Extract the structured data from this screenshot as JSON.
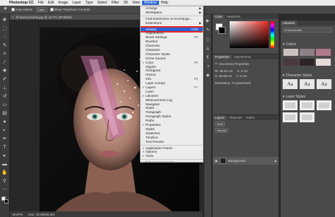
{
  "menubar": {
    "apple": "",
    "items": [
      {
        "label": "Photoshop CC",
        "app": true
      },
      {
        "label": "File"
      },
      {
        "label": "Edit"
      },
      {
        "label": "Image"
      },
      {
        "label": "Layer"
      },
      {
        "label": "Type"
      },
      {
        "label": "Select"
      },
      {
        "label": "Filter"
      },
      {
        "label": "3D"
      },
      {
        "label": "View"
      },
      {
        "label": "Window",
        "active": true
      },
      {
        "label": "Help"
      }
    ]
  },
  "optionsbar": {
    "auto_select": "Auto-Select:",
    "layer_select": "Layer",
    "show_transform": "Show Transform Controls"
  },
  "document": {
    "tab_title": "hl-beert-presets.jpg @ 16.7% (RGB/8#)",
    "zoom": "16.67%",
    "doc_size": "Doc: 40.2M/40.2M"
  },
  "window_menu": {
    "items": [
      {
        "label": "Arrange",
        "submenu": true
      },
      {
        "label": "Workspace",
        "submenu": true
      },
      {
        "sep": true
      },
      {
        "label": "Find Extensions on Exchange..."
      },
      {
        "label": "Extensions",
        "submenu": true
      },
      {
        "sep": true
      },
      {
        "label": "Actions",
        "shortcut": "⌥F9",
        "highlight": true
      },
      {
        "label": "Adjustments"
      },
      {
        "label": "Brush Settings",
        "shortcut": "F5"
      },
      {
        "label": "Brushes"
      },
      {
        "label": "Channels"
      },
      {
        "label": "Character"
      },
      {
        "label": "Character Styles"
      },
      {
        "label": "Clone Source"
      },
      {
        "label": "Color",
        "shortcut": "F6",
        "checked": true
      },
      {
        "label": "Glyphs"
      },
      {
        "label": "Histogram"
      },
      {
        "label": "History"
      },
      {
        "label": "Info",
        "shortcut": "F8"
      },
      {
        "label": "Layer Comps"
      },
      {
        "label": "Layers",
        "shortcut": "F7",
        "checked": true
      },
      {
        "label": "Learn"
      },
      {
        "label": "Libraries",
        "checked": true
      },
      {
        "label": "Measurement Log"
      },
      {
        "label": "Navigator"
      },
      {
        "label": "Notes"
      },
      {
        "label": "Paragraph"
      },
      {
        "label": "Paragraph Styles"
      },
      {
        "label": "Paths"
      },
      {
        "label": "Properties",
        "checked": true
      },
      {
        "label": "Styles"
      },
      {
        "label": "Swatches"
      },
      {
        "label": "Timeline"
      },
      {
        "label": "Tool Presets"
      },
      {
        "sep": true
      },
      {
        "label": "Application Frame",
        "checked": true
      },
      {
        "label": "Options",
        "checked": true
      },
      {
        "label": "Tools",
        "checked": true
      },
      {
        "sep": true
      },
      {
        "label": "hl-beert-presets.jpg",
        "checked": true
      }
    ]
  },
  "color_panel": {
    "tabs": [
      "Color",
      "Swatches"
    ]
  },
  "properties_panel": {
    "tabs": [
      "Properties",
      "Adjustments"
    ],
    "section": "Document Properties",
    "w_label": "W:",
    "w_value": "36.04 cm",
    "h_label": "H:",
    "h_value": "48.06 cm",
    "x_label": "X:",
    "x_value": "0 cm",
    "y_label": "Y:",
    "y_value": "0 cm",
    "resolution": "Resolution: 72 pixels/inch"
  },
  "layers_panel": {
    "tabs": [
      "Layers",
      "Channels",
      "Paths"
    ],
    "kind_label": "Kind",
    "blend_mode": "Normal",
    "layer_name": "Background"
  },
  "libraries_panel": {
    "title": "Libraries",
    "library_name": "hl-ba-ldsuede",
    "colors_label": "Colors",
    "char_styles_label": "Character Styles",
    "layer_styles_label": "Layer Styles",
    "char_style_glyph": "Aa",
    "swatches": [
      "#c9c1bf",
      "#8f7f86",
      "#b07989",
      "#4a3940",
      "#2e2528",
      "#e5dcd9"
    ]
  },
  "colors": {
    "accent": "#2a63d8",
    "highlight_outline": "#e8281f"
  }
}
